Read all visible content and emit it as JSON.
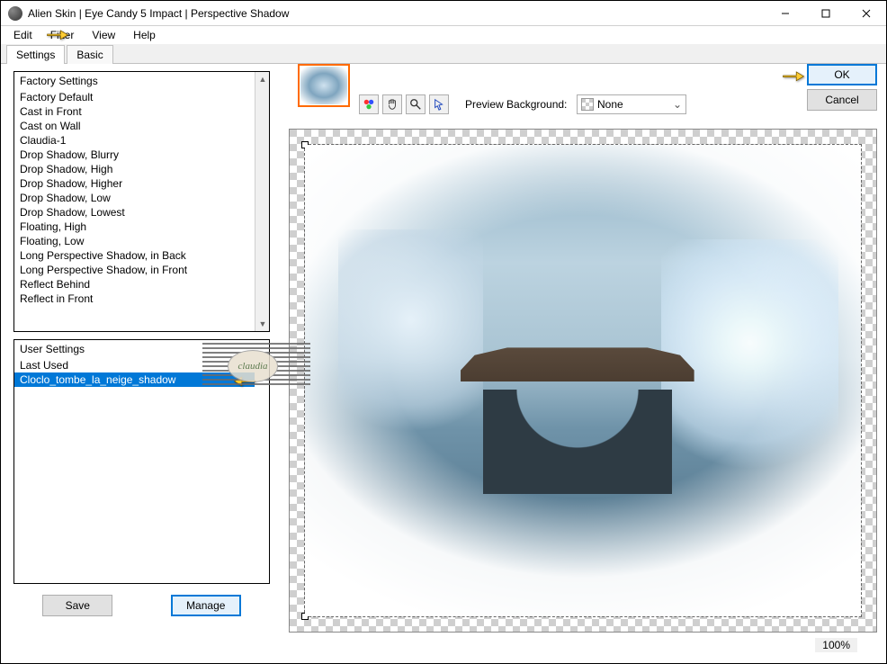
{
  "window": {
    "title": "Alien Skin | Eye Candy 5 Impact | Perspective Shadow"
  },
  "menu": {
    "edit": "Edit",
    "filter": "Filter",
    "view": "View",
    "help": "Help"
  },
  "tabs": {
    "settings": "Settings",
    "basic": "Basic"
  },
  "factory": {
    "header": "Factory Settings",
    "items": [
      "Factory Default",
      "Cast in Front",
      "Cast on Wall",
      "Claudia-1",
      "Drop Shadow, Blurry",
      "Drop Shadow, High",
      "Drop Shadow, Higher",
      "Drop Shadow, Low",
      "Drop Shadow, Lowest",
      "Floating, High",
      "Floating, Low",
      "Long Perspective Shadow, in Back",
      "Long Perspective Shadow, in Front",
      "Reflect Behind",
      "Reflect in Front"
    ]
  },
  "user": {
    "header": "User Settings",
    "last_used": "Last Used",
    "selected": "Cloclo_tombe_la_neige_shadow"
  },
  "buttons": {
    "save": "Save",
    "manage": "Manage",
    "ok": "OK",
    "cancel": "Cancel"
  },
  "preview": {
    "label": "Preview Background:",
    "value": "None"
  },
  "zoom": "100%",
  "watermark": "claudia"
}
